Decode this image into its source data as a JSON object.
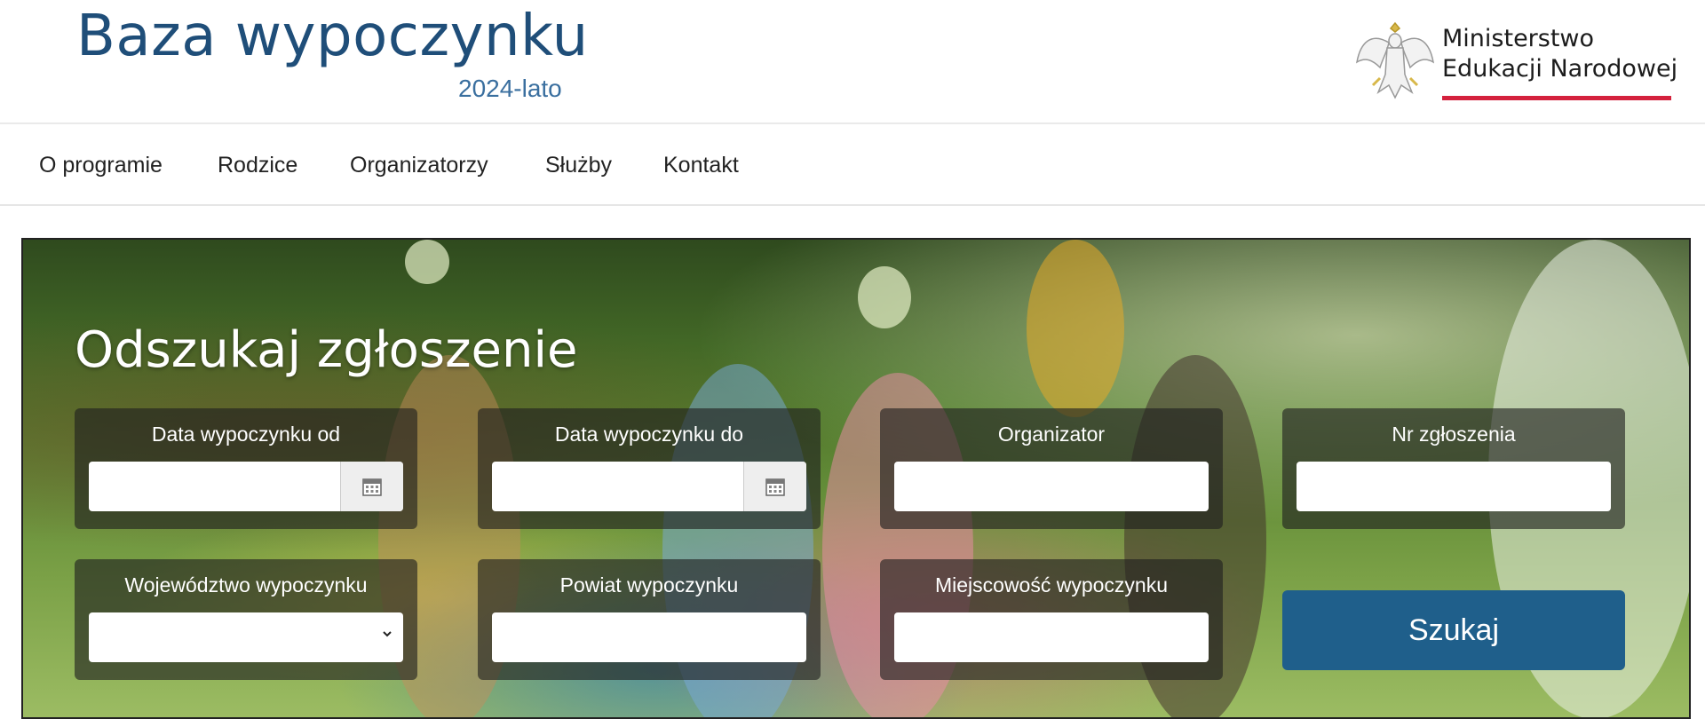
{
  "header": {
    "title": "Baza wypoczynku",
    "subtitle": "2024-lato",
    "ministry_line1": "Ministerstwo",
    "ministry_line2": "Edukacji Narodowej",
    "logo_icon": "polish-eagle-icon"
  },
  "nav": {
    "items": [
      {
        "label": "O programie"
      },
      {
        "label": "Rodzice"
      },
      {
        "label": "Organizatorzy"
      },
      {
        "label": "Służby"
      },
      {
        "label": "Kontakt"
      }
    ]
  },
  "hero": {
    "title": "Odszukaj zgłoszenie",
    "fields": [
      {
        "label": "Data wypoczynku od",
        "value": "",
        "type": "date"
      },
      {
        "label": "Data wypoczynku do",
        "value": "",
        "type": "date"
      },
      {
        "label": "Organizator",
        "value": "",
        "type": "text"
      },
      {
        "label": "Nr zgłoszenia",
        "value": "",
        "type": "text"
      },
      {
        "label": "Województwo wypoczynku",
        "value": "",
        "type": "select"
      },
      {
        "label": "Powiat wypoczynku",
        "value": "",
        "type": "text"
      },
      {
        "label": "Miejscowość wypoczynku",
        "value": "",
        "type": "text"
      }
    ],
    "search_label": "Szukaj"
  },
  "colors": {
    "brand": "#1f4e79",
    "accent_red": "#d4213d",
    "button": "#1f5f8b"
  }
}
